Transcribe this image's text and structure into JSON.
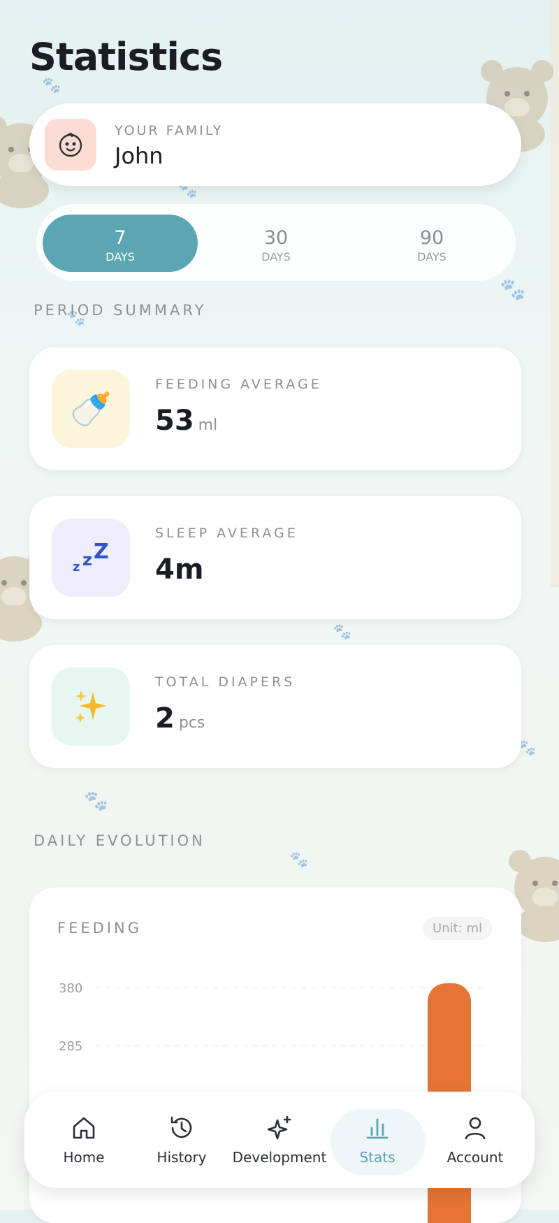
{
  "page": {
    "title": "Statistics"
  },
  "family": {
    "label": "YOUR FAMILY",
    "name": "John",
    "icon": "baby-face-icon"
  },
  "period_tabs": [
    {
      "value": "7",
      "unit": "DAYS",
      "active": true
    },
    {
      "value": "30",
      "unit": "DAYS",
      "active": false
    },
    {
      "value": "90",
      "unit": "DAYS",
      "active": false
    }
  ],
  "period_summary": {
    "label": "PERIOD SUMMARY",
    "cards": [
      {
        "label": "FEEDING AVERAGE",
        "value": "53",
        "unit": "ml",
        "icon": "baby-bottle-icon",
        "icon_bg": "#fbf5dc"
      },
      {
        "label": "SLEEP AVERAGE",
        "value": "4m",
        "unit": "",
        "icon": "zzz-icon",
        "icon_bg": "#efedfc"
      },
      {
        "label": "TOTAL DIAPERS",
        "value": "2",
        "unit": "pcs",
        "icon": "sparkles-icon",
        "icon_bg": "#e6f6f1"
      }
    ]
  },
  "daily_evolution": {
    "label": "DAILY EVOLUTION",
    "chart_title": "FEEDING",
    "unit_label": "Unit: ml"
  },
  "chart_data": {
    "type": "bar",
    "title": "FEEDING",
    "ylabel": "",
    "yticks": [
      380,
      285
    ],
    "series": [
      {
        "values": [
          380
        ]
      }
    ],
    "color": "#e57436"
  },
  "nav": [
    {
      "label": "Home",
      "icon": "home-icon",
      "active": false
    },
    {
      "label": "History",
      "icon": "history-icon",
      "active": false
    },
    {
      "label": "Development",
      "icon": "sparkle-development-icon",
      "active": false
    },
    {
      "label": "Stats",
      "icon": "bar-chart-icon",
      "active": true
    },
    {
      "label": "Account",
      "icon": "user-icon",
      "active": false
    }
  ],
  "colors": {
    "accent": "#5ba6b2",
    "chart_bar": "#e57436"
  }
}
